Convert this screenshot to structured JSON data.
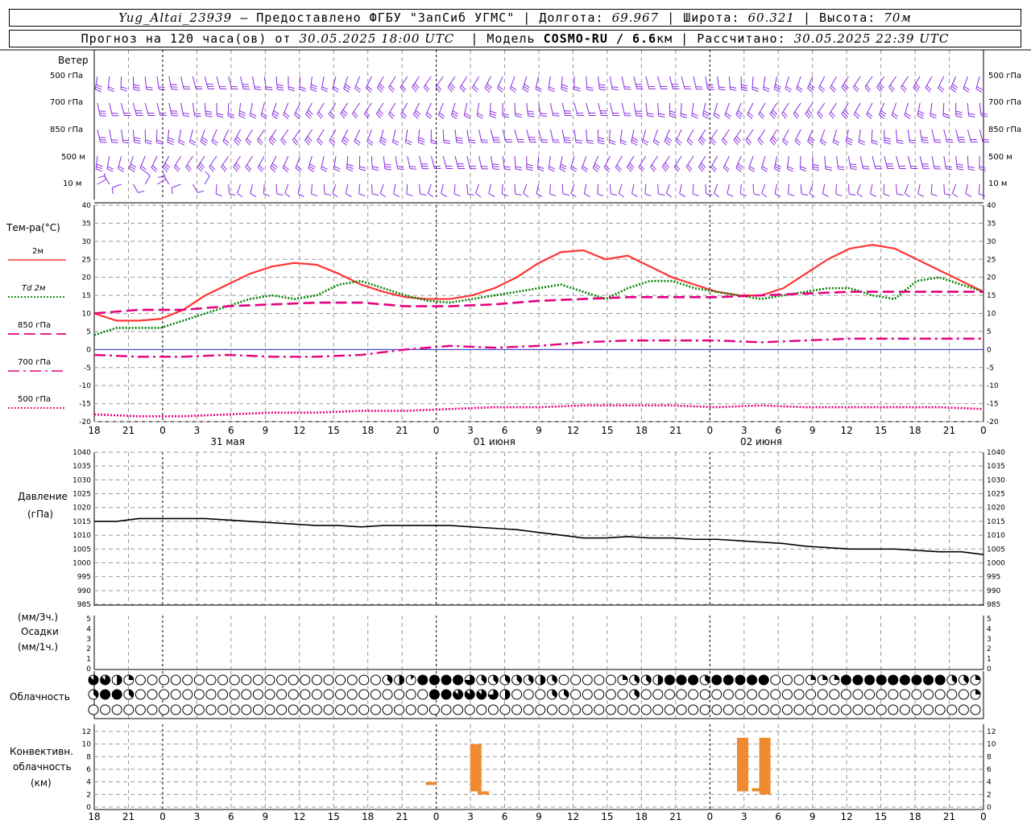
{
  "header": {
    "station": "Yug_Altai_23939",
    "provider": "– Предоставлено ФГБУ \"ЗапСиб УГМС\"",
    "lon_label": "Долгота:",
    "lon": "69.967",
    "lat_label": "Широта:",
    "lat": "60.321",
    "alt_label": "Высота:",
    "alt": "70м",
    "forecast_prefix": "Прогноз на 120 часа(ов) от",
    "forecast_start": "30.05.2025 18:00 UTC",
    "model_label": "Модель",
    "model": "COSMO-RU / 6.6",
    "model_unit": "км",
    "calc_label": "Рассчитано:",
    "calc_time": "30.05.2025 22:39 UTC"
  },
  "panels": {
    "wind": {
      "title": "Ветер",
      "levels": [
        "500 гПа",
        "700 гПа",
        "850 гПа",
        "500 м",
        "10 м"
      ]
    },
    "temperature": {
      "title": "Тем-ра(°C)",
      "legend": [
        {
          "label": "2м",
          "color": "#ff3333",
          "style": "solid"
        },
        {
          "label": "Td 2м",
          "color": "#008000",
          "style": "dotted"
        },
        {
          "label": "850 гПа",
          "color": "#e6007e",
          "style": "dashed"
        },
        {
          "label": "700 гПа",
          "color": "#e6007e",
          "style": "dashdot"
        },
        {
          "label": "500 гПа",
          "color": "#e6007e",
          "style": "dotted"
        }
      ]
    },
    "pressure": {
      "title": "Давление",
      "unit": "(гПа)"
    },
    "precip": {
      "unit_top": "(мм/3ч.)",
      "title": "Осадки",
      "unit_bottom": "(мм/1ч.)"
    },
    "clouds": {
      "title": "Облачность"
    },
    "convective": {
      "title_1": "Конвективн.",
      "title_2": "облачность",
      "unit": "(км)"
    }
  },
  "axis": {
    "hour_ticks": [
      "18",
      "21",
      "0",
      "3",
      "6",
      "9",
      "12",
      "15",
      "18",
      "21",
      "0",
      "3",
      "6",
      "9",
      "12",
      "15",
      "18",
      "21",
      "0",
      "3",
      "6",
      "9",
      "12",
      "15",
      "18",
      "21",
      "0"
    ],
    "dates": [
      "31 мая",
      "01 июня",
      "02 июня"
    ],
    "temp_ticks": [
      "40",
      "35",
      "30",
      "25",
      "20",
      "15",
      "10",
      "5",
      "0",
      "-5",
      "-10",
      "-15",
      "-20"
    ],
    "pressure_ticks": [
      "1040",
      "1035",
      "1030",
      "1025",
      "1020",
      "1015",
      "1010",
      "1005",
      "1000",
      "995",
      "990",
      "985"
    ],
    "precip_ticks": [
      "5",
      "4",
      "3",
      "2",
      "1",
      "0"
    ],
    "conv_ticks": [
      "12",
      "10",
      "8",
      "6",
      "4",
      "2",
      "0"
    ]
  },
  "chart_data": [
    {
      "type": "line",
      "panel": "temperature",
      "x_unit": "hours since 30.05.2025 18:00 UTC",
      "ylim": [
        -20,
        40
      ],
      "series": [
        {
          "name": "2м",
          "color": "#ff3333",
          "x": [
            0,
            3,
            6,
            9,
            12,
            15,
            18,
            21,
            24,
            27,
            30,
            33,
            36,
            39,
            42,
            45,
            48,
            51,
            54,
            57,
            60,
            63,
            66,
            69,
            72,
            75,
            78,
            81,
            84,
            87,
            90,
            93,
            96,
            99,
            102,
            105,
            108,
            111,
            114,
            117,
            120
          ],
          "values": [
            10,
            8,
            8,
            8.5,
            11,
            15,
            18,
            21,
            23,
            24,
            23.5,
            21,
            18,
            16,
            14.5,
            14,
            14,
            15,
            17,
            20,
            24,
            27,
            27.5,
            25,
            26,
            23,
            20,
            18,
            16,
            15,
            15,
            17,
            21,
            25,
            28,
            29,
            28,
            25,
            22,
            19,
            16
          ]
        },
        {
          "name": "Td 2м",
          "color": "#008000",
          "x": [
            0,
            3,
            6,
            9,
            12,
            15,
            18,
            21,
            24,
            27,
            30,
            33,
            36,
            39,
            42,
            45,
            48,
            51,
            54,
            57,
            60,
            63,
            66,
            69,
            72,
            75,
            78,
            81,
            84,
            87,
            90,
            93,
            96,
            99,
            102,
            105,
            108,
            111,
            114,
            117,
            120
          ],
          "values": [
            4,
            6,
            6,
            6,
            8,
            10,
            12,
            14,
            15,
            14,
            15,
            18,
            19,
            17,
            15,
            13.5,
            13,
            14,
            15,
            16,
            17,
            18,
            16,
            14,
            17,
            19,
            19,
            17,
            16,
            15,
            14,
            15,
            16,
            17,
            17,
            15,
            14,
            19,
            20,
            18,
            16
          ]
        },
        {
          "name": "850 гПа",
          "color": "#e6007e",
          "x": [
            0,
            6,
            12,
            18,
            24,
            30,
            36,
            42,
            48,
            54,
            60,
            66,
            72,
            78,
            84,
            90,
            96,
            102,
            108,
            114,
            120
          ],
          "values": [
            10,
            11,
            11,
            12,
            12.5,
            13,
            13,
            12,
            12,
            12.5,
            13.5,
            14,
            14.5,
            14.5,
            14.5,
            15,
            15.5,
            16,
            16,
            16,
            16
          ]
        },
        {
          "name": "700 гПа",
          "color": "#e6007e",
          "x": [
            0,
            6,
            12,
            18,
            24,
            30,
            36,
            42,
            48,
            54,
            60,
            66,
            72,
            78,
            84,
            90,
            96,
            102,
            108,
            114,
            120
          ],
          "values": [
            -1.5,
            -2,
            -2,
            -1.5,
            -2,
            -2,
            -1.5,
            0,
            1,
            0.5,
            1,
            2,
            2.5,
            2.5,
            2.5,
            2,
            2.5,
            3,
            3,
            3,
            3
          ]
        },
        {
          "name": "500 гПа",
          "color": "#e6007e",
          "x": [
            0,
            6,
            12,
            18,
            24,
            30,
            36,
            42,
            48,
            54,
            60,
            66,
            72,
            78,
            84,
            90,
            96,
            102,
            108,
            114,
            120
          ],
          "values": [
            -18,
            -18.5,
            -18.5,
            -18,
            -17.5,
            -17.5,
            -17,
            -17,
            -16.5,
            -16,
            -16,
            -15.5,
            -15.5,
            -15.5,
            -16,
            -15.5,
            -16,
            -16,
            -16,
            -16,
            -16.5
          ]
        }
      ]
    },
    {
      "type": "line",
      "panel": "pressure",
      "x_unit": "hours since 30.05.2025 18:00 UTC",
      "ylim": [
        985,
        1040
      ],
      "series": [
        {
          "name": "",
          "color": "#000000",
          "x": [
            0,
            3,
            6,
            9,
            12,
            15,
            18,
            21,
            24,
            27,
            30,
            33,
            36,
            39,
            42,
            45,
            48,
            51,
            54,
            57,
            60,
            63,
            66,
            69,
            72,
            75,
            78,
            81,
            84,
            87,
            90,
            93,
            96,
            99,
            102,
            105,
            108,
            111,
            114,
            117,
            120
          ],
          "values": [
            1015,
            1015,
            1016,
            1016,
            1016,
            1016,
            1015.5,
            1015,
            1014.5,
            1014,
            1013.5,
            1013.5,
            1013,
            1013.5,
            1013.5,
            1013.5,
            1013.5,
            1013,
            1012.5,
            1012,
            1011,
            1010,
            1009,
            1009,
            1009.5,
            1009,
            1009,
            1008.5,
            1008.5,
            1008,
            1007.5,
            1007,
            1006,
            1005.5,
            1005,
            1005,
            1005,
            1004.5,
            1004,
            1004,
            1003
          ]
        }
      ]
    },
    {
      "type": "bar",
      "panel": "convective",
      "note": "bars show cloud base to top in km",
      "bars": [
        {
          "x": 45.5,
          "bottom": 3.5,
          "top": 4.0
        },
        {
          "x": 51.5,
          "bottom": 2.5,
          "top": 10.0
        },
        {
          "x": 52.5,
          "bottom": 2.0,
          "top": 2.5
        },
        {
          "x": 87.5,
          "bottom": 2.5,
          "top": 11.0
        },
        {
          "x": 89.5,
          "bottom": 2.5,
          "top": 3.0
        },
        {
          "x": 90.5,
          "bottom": 2.0,
          "top": 11.0
        }
      ],
      "ylim": [
        0,
        13
      ]
    }
  ],
  "cloud_rows": {
    "row1": "7742000000000000000000000341888863333343000002334888388888000222888888888332",
    "row2": "3883000000000000000000000000088777640003300000300000000000000000000000000002",
    "row3": "0000000000000000000000000000000000000000000000000000000000000000000000000000"
  }
}
